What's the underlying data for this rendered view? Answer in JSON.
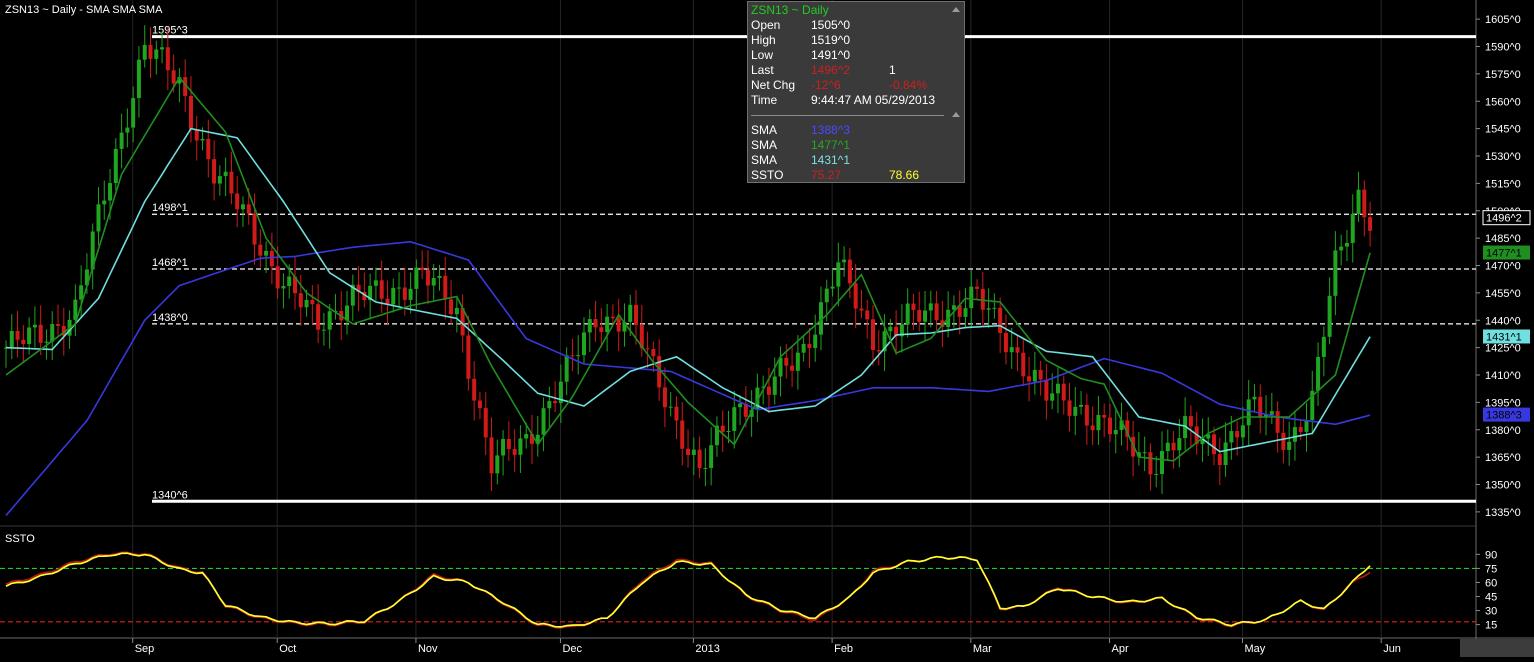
{
  "header": {
    "title": "ZSN13 ~ Daily  -  SMA SMA SMA",
    "ssto_label": "SSTO"
  },
  "colors": {
    "up": "#1fa51f",
    "down": "#d11a1a",
    "sma_long": "#3838e0",
    "sma_mid": "#1f8f1f",
    "sma_fast": "#6fdfdf",
    "ssto_k": "#b01818",
    "ssto_d": "#ffff33",
    "band_guides": "#22cc22",
    "low_guide": "#dd2222"
  },
  "tooltip": {
    "title": "ZSN13 ~ Daily",
    "rows": [
      {
        "label": "Open",
        "value": "1505^0",
        "color": "#ffffff"
      },
      {
        "label": "High",
        "value": "1519^0",
        "color": "#ffffff"
      },
      {
        "label": "Low",
        "value": "1491^0",
        "color": "#ffffff"
      },
      {
        "label": "Last",
        "value": "1496^2",
        "value2": "1",
        "color": "#cc2020"
      },
      {
        "label": "Net Chg",
        "value": "-12^6",
        "value2": "-0.84%",
        "color": "#cc2020"
      },
      {
        "label": "Time",
        "value": "9:44:47 AM",
        "value2": "05/29/2013",
        "color": "#ffffff"
      }
    ],
    "studies": [
      {
        "label": "SMA",
        "value": "1388^3",
        "color": "#4a4aff"
      },
      {
        "label": "SMA",
        "value": "1477^1",
        "color": "#22aa22"
      },
      {
        "label": "SMA",
        "value": "1431^1",
        "color": "#7fe0e0"
      },
      {
        "label": "SSTO",
        "value": "75.27",
        "value2": "78.66",
        "color": "#cc2020",
        "color2": "#ffff33"
      }
    ]
  },
  "chart_data": [
    {
      "type": "candlestick",
      "ylim": [
        1330,
        1610
      ],
      "yticks": [
        "1335^0",
        "1350^0",
        "1365^0",
        "1380^0",
        "1395^0",
        "1410^0",
        "1425^0",
        "1440^0",
        "1455^0",
        "1470^0",
        "1485^0",
        "1500^0",
        "1515^0",
        "1530^0",
        "1545^0",
        "1560^0",
        "1575^0",
        "1590^0",
        "1605^0"
      ],
      "ytick_values": [
        1335,
        1350,
        1365,
        1380,
        1395,
        1410,
        1425,
        1440,
        1455,
        1470,
        1485,
        1500,
        1515,
        1530,
        1545,
        1560,
        1575,
        1590,
        1605
      ],
      "xticks": [
        "Sep",
        "Oct",
        "Nov",
        "Dec",
        "2013",
        "Feb",
        "Mar",
        "Apr",
        "May",
        "Jun"
      ],
      "xtick_index": [
        24,
        49,
        73,
        98,
        121,
        145,
        169,
        193,
        216,
        240
      ],
      "levels": [
        {
          "label": "1595^3",
          "value": 1595.4,
          "style": "solid"
        },
        {
          "label": "1498^1",
          "value": 1498.1,
          "style": "dashed"
        },
        {
          "label": "1468^1",
          "value": 1468.1,
          "style": "dashed"
        },
        {
          "label": "1438^0",
          "value": 1438.0,
          "style": "dashed"
        },
        {
          "label": "1340^6",
          "value": 1340.8,
          "style": "solid"
        }
      ],
      "last_tags": [
        {
          "label": "1496^2",
          "value": 1496.2,
          "bg": "#000000",
          "fg": "#ffffff"
        },
        {
          "label": "1477^1",
          "value": 1477.1,
          "bg": "#1f8f1f",
          "fg": "#000000"
        },
        {
          "label": "1431^1",
          "value": 1431.1,
          "bg": "#6fdfdf",
          "fg": "#000000"
        },
        {
          "label": "1388^3",
          "value": 1388.3,
          "bg": "#3838e0",
          "fg": "#000000"
        }
      ],
      "sma_long_anchors": [
        [
          0,
          1333
        ],
        [
          14,
          1385
        ],
        [
          24,
          1440
        ],
        [
          30,
          1459
        ],
        [
          44,
          1474
        ],
        [
          50,
          1475
        ],
        [
          60,
          1480
        ],
        [
          70,
          1483
        ],
        [
          80,
          1473
        ],
        [
          90,
          1430
        ],
        [
          100,
          1416
        ],
        [
          115,
          1412
        ],
        [
          130,
          1391
        ],
        [
          140,
          1396
        ],
        [
          150,
          1403
        ],
        [
          160,
          1403
        ],
        [
          170,
          1401
        ],
        [
          180,
          1407
        ],
        [
          190,
          1419
        ],
        [
          200,
          1411
        ],
        [
          210,
          1394
        ],
        [
          220,
          1387
        ],
        [
          230,
          1383
        ],
        [
          236,
          1388
        ]
      ],
      "sma_mid_anchors": [
        [
          0,
          1410
        ],
        [
          12,
          1438
        ],
        [
          20,
          1520
        ],
        [
          30,
          1573
        ],
        [
          38,
          1543
        ],
        [
          45,
          1485
        ],
        [
          52,
          1455
        ],
        [
          60,
          1438
        ],
        [
          70,
          1448
        ],
        [
          78,
          1453
        ],
        [
          84,
          1415
        ],
        [
          92,
          1372
        ],
        [
          98,
          1398
        ],
        [
          106,
          1443
        ],
        [
          112,
          1417
        ],
        [
          118,
          1395
        ],
        [
          126,
          1372
        ],
        [
          134,
          1420
        ],
        [
          142,
          1443
        ],
        [
          148,
          1465
        ],
        [
          154,
          1422
        ],
        [
          160,
          1430
        ],
        [
          166,
          1452
        ],
        [
          172,
          1450
        ],
        [
          180,
          1418
        ],
        [
          186,
          1408
        ],
        [
          190,
          1405
        ],
        [
          196,
          1365
        ],
        [
          202,
          1363
        ],
        [
          208,
          1378
        ],
        [
          214,
          1387
        ],
        [
          222,
          1387
        ],
        [
          230,
          1410
        ],
        [
          236,
          1477
        ]
      ],
      "sma_fast_anchors": [
        [
          0,
          1425
        ],
        [
          8,
          1424
        ],
        [
          16,
          1452
        ],
        [
          24,
          1505
        ],
        [
          32,
          1545
        ],
        [
          40,
          1540
        ],
        [
          48,
          1505
        ],
        [
          56,
          1466
        ],
        [
          64,
          1450
        ],
        [
          70,
          1446
        ],
        [
          78,
          1441
        ],
        [
          86,
          1418
        ],
        [
          92,
          1400
        ],
        [
          100,
          1393
        ],
        [
          108,
          1412
        ],
        [
          116,
          1420
        ],
        [
          124,
          1403
        ],
        [
          132,
          1390
        ],
        [
          140,
          1393
        ],
        [
          148,
          1410
        ],
        [
          154,
          1432
        ],
        [
          160,
          1433
        ],
        [
          166,
          1436
        ],
        [
          172,
          1437
        ],
        [
          180,
          1423
        ],
        [
          188,
          1420
        ],
        [
          196,
          1387
        ],
        [
          204,
          1382
        ],
        [
          210,
          1368
        ],
        [
          218,
          1373
        ],
        [
          226,
          1378
        ],
        [
          236,
          1431
        ]
      ],
      "candle_anchors": [
        [
          0,
          1425
        ],
        [
          6,
          1432
        ],
        [
          12,
          1445
        ],
        [
          18,
          1520
        ],
        [
          24,
          1590
        ],
        [
          30,
          1570
        ],
        [
          36,
          1520
        ],
        [
          42,
          1495
        ],
        [
          48,
          1458
        ],
        [
          54,
          1440
        ],
        [
          60,
          1452
        ],
        [
          66,
          1455
        ],
        [
          72,
          1465
        ],
        [
          78,
          1445
        ],
        [
          84,
          1360
        ],
        [
          90,
          1375
        ],
        [
          96,
          1405
        ],
        [
          102,
          1442
        ],
        [
          108,
          1440
        ],
        [
          114,
          1400
        ],
        [
          120,
          1355
        ],
        [
          126,
          1392
        ],
        [
          132,
          1402
        ],
        [
          138,
          1425
        ],
        [
          144,
          1470
        ],
        [
          150,
          1430
        ],
        [
          156,
          1440
        ],
        [
          162,
          1445
        ],
        [
          168,
          1452
        ],
        [
          174,
          1426
        ],
        [
          180,
          1398
        ],
        [
          186,
          1392
        ],
        [
          192,
          1378
        ],
        [
          198,
          1362
        ],
        [
          204,
          1378
        ],
        [
          210,
          1370
        ],
        [
          216,
          1392
        ],
        [
          222,
          1375
        ],
        [
          226,
          1395
        ],
        [
          230,
          1470
        ],
        [
          234,
          1510
        ],
        [
          236,
          1496
        ]
      ]
    },
    {
      "type": "line",
      "title": "SSTO",
      "ylim": [
        5,
        100
      ],
      "yticks": [
        "90",
        "75",
        "60",
        "45",
        "30",
        "15"
      ],
      "ytick_values": [
        90,
        75,
        60,
        45,
        30,
        15
      ],
      "guides": [
        75,
        18
      ],
      "k_anchors": [
        [
          0,
          58
        ],
        [
          6,
          68
        ],
        [
          12,
          82
        ],
        [
          18,
          91
        ],
        [
          24,
          91
        ],
        [
          30,
          75
        ],
        [
          34,
          71
        ],
        [
          38,
          35
        ],
        [
          44,
          22
        ],
        [
          50,
          16
        ],
        [
          56,
          15
        ],
        [
          62,
          18
        ],
        [
          68,
          40
        ],
        [
          74,
          68
        ],
        [
          80,
          60
        ],
        [
          86,
          38
        ],
        [
          92,
          14
        ],
        [
          98,
          12
        ],
        [
          104,
          22
        ],
        [
          110,
          62
        ],
        [
          116,
          84
        ],
        [
          122,
          80
        ],
        [
          128,
          46
        ],
        [
          134,
          30
        ],
        [
          140,
          20
        ],
        [
          146,
          44
        ],
        [
          150,
          72
        ],
        [
          156,
          82
        ],
        [
          162,
          87
        ],
        [
          168,
          85
        ],
        [
          172,
          32
        ],
        [
          176,
          34
        ],
        [
          182,
          55
        ],
        [
          188,
          45
        ],
        [
          194,
          38
        ],
        [
          200,
          43
        ],
        [
          206,
          22
        ],
        [
          212,
          14
        ],
        [
          218,
          20
        ],
        [
          224,
          40
        ],
        [
          228,
          30
        ],
        [
          232,
          55
        ],
        [
          236,
          72
        ],
        [
          240,
          98
        ],
        [
          242,
          80
        ],
        [
          236,
          75
        ]
      ],
      "d_anchors": [
        [
          0,
          56
        ],
        [
          6,
          66
        ],
        [
          12,
          80
        ],
        [
          18,
          90
        ],
        [
          24,
          90
        ],
        [
          30,
          74
        ],
        [
          34,
          70
        ],
        [
          38,
          36
        ],
        [
          44,
          23
        ],
        [
          50,
          17
        ],
        [
          56,
          16
        ],
        [
          62,
          19
        ],
        [
          68,
          40
        ],
        [
          74,
          66
        ],
        [
          80,
          60
        ],
        [
          86,
          39
        ],
        [
          92,
          15
        ],
        [
          98,
          13
        ],
        [
          104,
          22
        ],
        [
          110,
          60
        ],
        [
          116,
          82
        ],
        [
          122,
          79
        ],
        [
          128,
          47
        ],
        [
          134,
          31
        ],
        [
          140,
          22
        ],
        [
          146,
          44
        ],
        [
          150,
          70
        ],
        [
          156,
          82
        ],
        [
          162,
          87
        ],
        [
          168,
          85
        ],
        [
          172,
          33
        ],
        [
          176,
          34
        ],
        [
          182,
          54
        ],
        [
          188,
          45
        ],
        [
          194,
          39
        ],
        [
          200,
          43
        ],
        [
          206,
          23
        ],
        [
          212,
          15
        ],
        [
          218,
          20
        ],
        [
          224,
          40
        ],
        [
          228,
          31
        ],
        [
          232,
          54
        ],
        [
          236,
          79
        ]
      ]
    }
  ]
}
